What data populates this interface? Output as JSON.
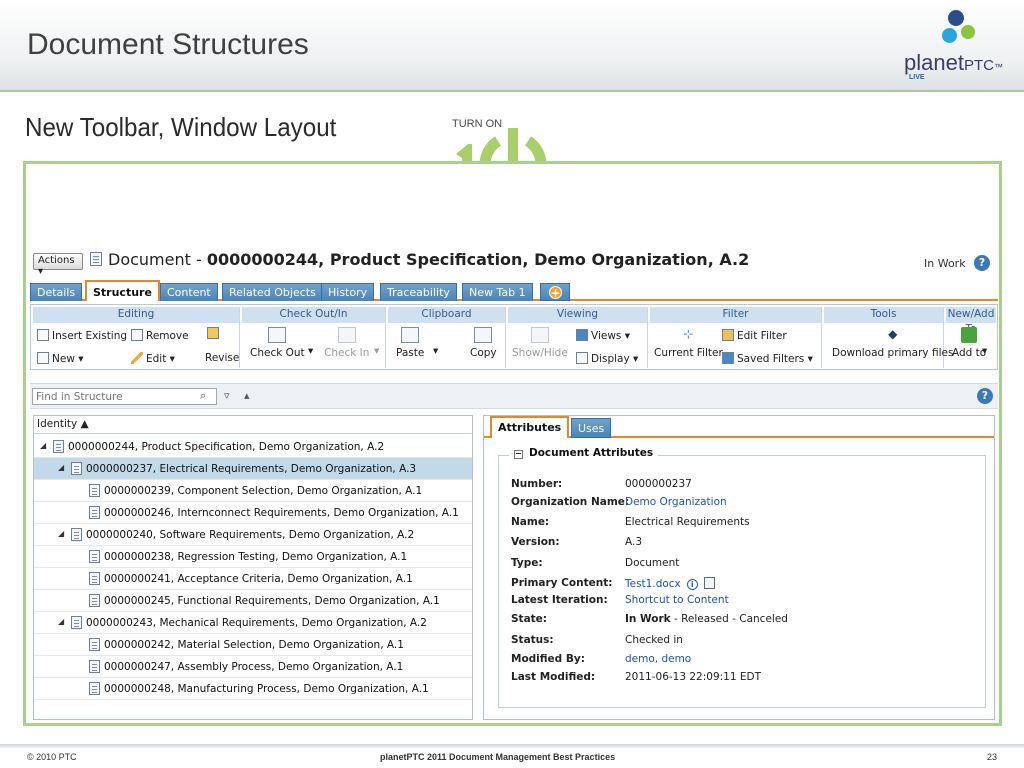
{
  "slide": {
    "title": "Document Structures",
    "subtitle": "New Toolbar, Window Layout",
    "badge_top": "TURN ON",
    "badge_number": "10",
    "logo_text": "planet",
    "logo_text_bold": "PTC",
    "logo_trademark": "™",
    "logo_live": "LIVE",
    "footer_left": "© 2010 PTC",
    "footer_center": "planetPTC 2011 Document Management Best Practices",
    "footer_page": "23",
    "accent_green": "#a9d18e"
  },
  "app": {
    "actions_label": "Actions ▾",
    "doc_prefix": "Document - ",
    "doc_title": "0000000244, Product Specification, Demo Organization, A.2",
    "state": "In Work",
    "help": "?",
    "tabs": [
      "Details",
      "Structure",
      "Content",
      "Related Objects",
      "History",
      "Traceability",
      "New Tab 1"
    ],
    "active_tab": "Structure",
    "tab_add": "+",
    "ribbon": {
      "editing": {
        "title": "Editing",
        "insert_existing": "Insert Existing",
        "remove": "Remove",
        "new": "New",
        "edit": "Edit",
        "revise": "Revise"
      },
      "checkout": {
        "title": "Check Out/In",
        "check_out": "Check Out",
        "check_in": "Check In"
      },
      "clipboard": {
        "title": "Clipboard",
        "paste": "Paste",
        "copy": "Copy"
      },
      "viewing": {
        "title": "Viewing",
        "show_hide": "Show/Hide",
        "views": "Views",
        "display": "Display"
      },
      "filter": {
        "title": "Filter",
        "current_filter": "Current Filter",
        "edit_filter": "Edit Filter",
        "saved_filters": "Saved Filters"
      },
      "tools": {
        "title": "Tools",
        "download": "Download primary files"
      },
      "newadd": {
        "title": "New/Add To",
        "add_to": "Add to"
      }
    },
    "find": {
      "placeholder": "Find in Structure",
      "help": "?"
    },
    "tree": {
      "column": "Identity ▲",
      "rows": [
        {
          "label": "0000000244, Product Specification, Demo Organization, A.2",
          "level": 0,
          "expander": "◢"
        },
        {
          "label": "0000000237, Electrical Requirements, Demo Organization, A.3",
          "level": 1,
          "expander": "◢",
          "selected": true
        },
        {
          "label": "0000000239, Component Selection, Demo Organization, A.1",
          "level": 2,
          "expander": ""
        },
        {
          "label": "0000000246, Internconnect Requirements, Demo Organization, A.1",
          "level": 2,
          "expander": ""
        },
        {
          "label": "0000000240, Software Requirements, Demo Organization, A.2",
          "level": 1,
          "expander": "◢"
        },
        {
          "label": "0000000238, Regression Testing, Demo Organization, A.1",
          "level": 2,
          "expander": ""
        },
        {
          "label": "0000000241, Acceptance Criteria, Demo Organization, A.1",
          "level": 2,
          "expander": ""
        },
        {
          "label": "0000000245, Functional Requirements, Demo Organization, A.1",
          "level": 2,
          "expander": ""
        },
        {
          "label": "0000000243, Mechanical Requirements, Demo Organization, A.2",
          "level": 1,
          "expander": "◢"
        },
        {
          "label": "0000000242, Material Selection, Demo Organization, A.1",
          "level": 2,
          "expander": ""
        },
        {
          "label": "0000000247, Assembly Process, Demo Organization, A.1",
          "level": 2,
          "expander": ""
        },
        {
          "label": "0000000248, Manufacturing Process, Demo Organization, A.1",
          "level": 2,
          "expander": ""
        }
      ]
    },
    "attributes": {
      "tab_attributes": "Attributes",
      "tab_uses": "Uses",
      "section": "Document Attributes",
      "collapse": "−",
      "rows": [
        {
          "key": "Number:",
          "value": "0000000237",
          "link": false
        },
        {
          "key": "Organization Name:",
          "value": "Demo Organization",
          "link": true
        },
        {
          "key": "Name:",
          "value": "Electrical Requirements",
          "link": false
        },
        {
          "key": "Version:",
          "value": "A.3",
          "link": false
        },
        {
          "key": "Type:",
          "value": "Document",
          "link": false
        },
        {
          "key": "Primary Content:",
          "value": "Test1.docx",
          "link": true
        },
        {
          "key": "Latest Iteration:",
          "value": "Shortcut to Content",
          "link": true
        },
        {
          "key": "State:",
          "value_bold": "In Work",
          "value": " - Released - Canceled",
          "link": false
        },
        {
          "key": "Status:",
          "value": "Checked in",
          "link": false
        },
        {
          "key": "Modified By:",
          "value": "demo, demo",
          "link": true
        },
        {
          "key": "Last Modified:",
          "value": "2011-06-13 22:09:11 EDT",
          "link": false
        }
      ]
    }
  }
}
